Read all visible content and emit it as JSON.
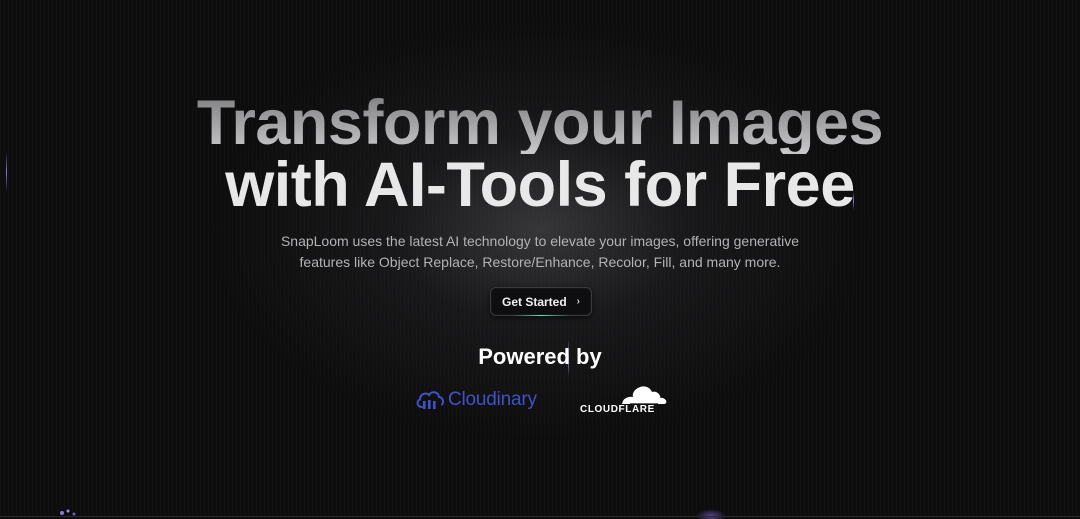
{
  "hero": {
    "title_line1": "Transform your Images",
    "title_line2": "with AI-Tools for Free",
    "subtitle_line1": "SnapLoom uses the latest AI technology to elevate your images, offering generative",
    "subtitle_line2": "features like Object Replace, Restore/Enhance, Recolor, Fill, and many more.",
    "cta_label": "Get Started",
    "cta_icon": "chevron-right-icon"
  },
  "partners": {
    "heading": "Powered by",
    "logos": [
      {
        "name": "Cloudinary",
        "label": "Cloudinary",
        "color": "#3f52c6",
        "icon": "cloudinary-logo"
      },
      {
        "name": "Cloudflare",
        "label": "CLOUDFLARE",
        "color": "#ffffff",
        "icon": "cloudflare-logo"
      }
    ]
  },
  "colors": {
    "background": "#0d0d0e",
    "accent_glow": "#5fe0b5",
    "sparkle": "#8b7bd8"
  }
}
